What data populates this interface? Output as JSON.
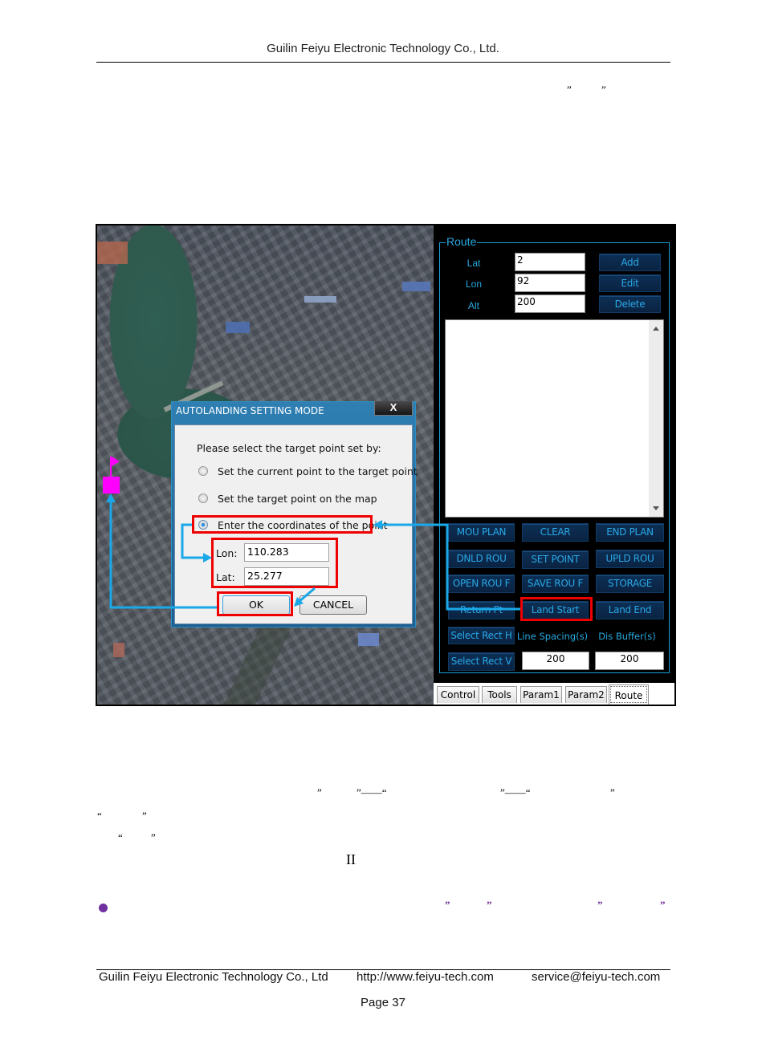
{
  "header": {
    "company": "Guilin Feiyu Electronic Technology Co., Ltd."
  },
  "body_marks": {
    "top_quotes": [
      "”",
      "”"
    ],
    "para_line1_marks": [
      "”",
      "”——“",
      "”——“",
      "”"
    ],
    "para_line2_marks": [
      "“",
      "”"
    ],
    "para_line3_marks": [
      "“",
      "”"
    ],
    "roman_numeral": "II",
    "bullet_marks": [
      "”",
      "”",
      "”",
      "”"
    ]
  },
  "screenshot": {
    "route_panel": {
      "group_title": "Route",
      "fields": [
        {
          "label": "Lat",
          "value": "2"
        },
        {
          "label": "Lon",
          "value": "92"
        },
        {
          "label": "Alt",
          "value": "200"
        }
      ],
      "side_buttons": [
        "Add",
        "Edit",
        "Delete"
      ],
      "grid_buttons": [
        [
          "MOU PLAN",
          "CLEAR",
          "END PLAN"
        ],
        [
          "DNLD ROU",
          "SET POINT",
          "UPLD ROU"
        ],
        [
          "OPEN ROU F",
          "SAVE ROU F",
          "STORAGE"
        ],
        [
          "Return Pt",
          "Land Start",
          "Land End"
        ]
      ],
      "select_rect_h": "Select Rect H",
      "select_rect_v": "Select Rect V",
      "line_spacing_label": "Line Spacing(s)",
      "dis_buffer_label": "Dis Buffer(s)",
      "line_spacing_value": "200",
      "dis_buffer_value": "200",
      "tabs": [
        "Control",
        "Tools",
        "Param1",
        "Param2",
        "Route"
      ],
      "active_tab": "Route"
    },
    "dialog": {
      "title": "AUTOLANDING SETTING MODE",
      "close_label": "X",
      "prompt": "Please select the target point set by:",
      "options": [
        "Set the current point to the target point",
        "Set the target point on the map",
        "Enter the coordinates of the point"
      ],
      "selected_option": 2,
      "lon_label": "Lon:",
      "lon_value": "110.283",
      "lat_label": "Lat:",
      "lat_value": "25.277",
      "ok_label": "OK",
      "cancel_label": "CANCEL"
    },
    "colors": {
      "highlight_box": "#ee0000",
      "arrow": "#1aa8e8",
      "marker": "#ff00ff",
      "panel_accent": "#27a9e1"
    }
  },
  "footer": {
    "company": "Guilin Feiyu Electronic Technology Co., Ltd",
    "website": "http://www.feiyu-tech.com",
    "email": "service@feiyu-tech.com",
    "page": "Page 37"
  }
}
